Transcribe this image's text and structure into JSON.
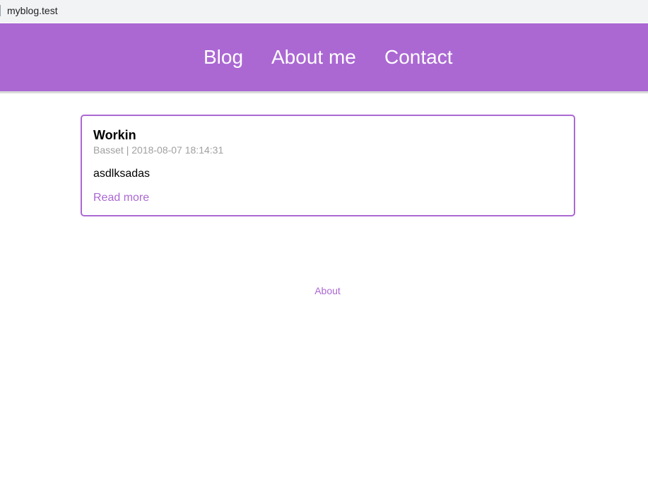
{
  "browser": {
    "url": "myblog.test"
  },
  "header": {
    "nav": [
      {
        "label": "Blog"
      },
      {
        "label": "About me"
      },
      {
        "label": "Contact"
      }
    ]
  },
  "post": {
    "title": "Workin",
    "author": "Basset",
    "separator": "|",
    "date": "2018-08-07 18:14:31",
    "excerpt": "asdlksadas",
    "read_more": "Read more"
  },
  "footer": {
    "link": "About"
  },
  "colors": {
    "accent": "#ab68d3",
    "header_bg": "#ab68d3",
    "meta_text": "#a0a0a0"
  }
}
